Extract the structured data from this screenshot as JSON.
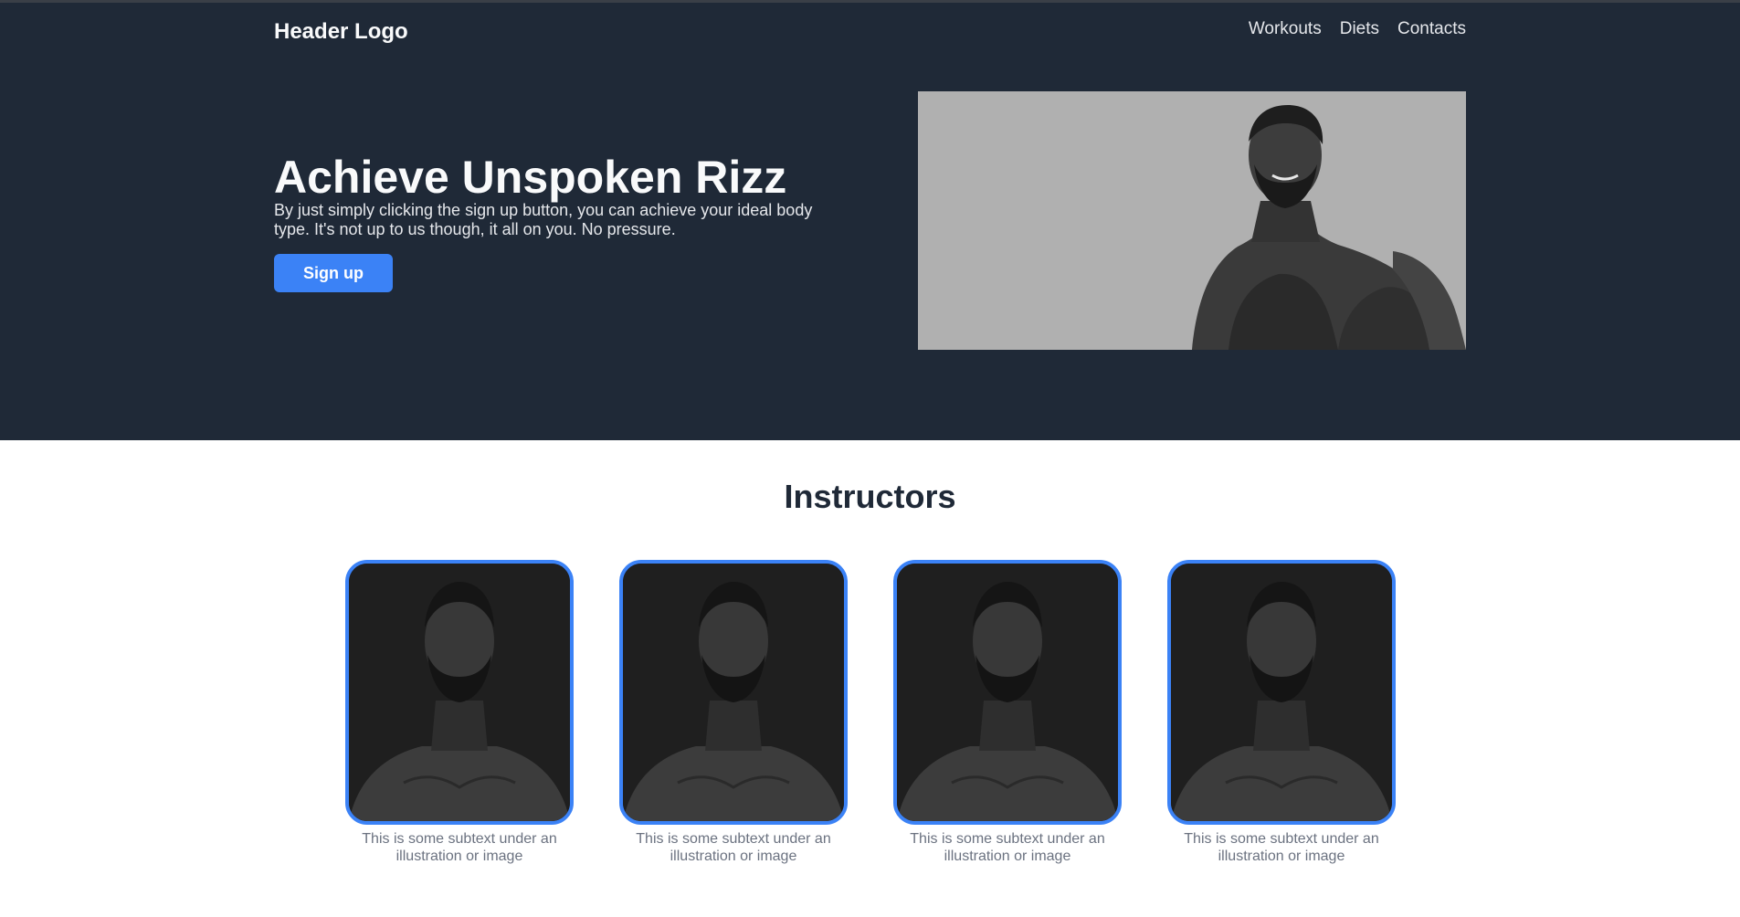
{
  "header": {
    "logo": "Header Logo",
    "nav": [
      {
        "label": "Workouts"
      },
      {
        "label": "Diets"
      },
      {
        "label": "Contacts"
      }
    ]
  },
  "hero": {
    "title": "Achieve Unspoken Rizz",
    "subtitle": "By just simply clicking the sign up button, you can achieve your ideal body type. It's not up to us though, it all on you. No pressure.",
    "cta_label": "Sign up",
    "image_icon": "muscular-man-portrait"
  },
  "instructors": {
    "title": "Instructors",
    "cards": [
      {
        "caption": "This is some subtext under an illustration or image",
        "image_icon": "instructor-portrait"
      },
      {
        "caption": "This is some subtext under an illustration or image",
        "image_icon": "instructor-portrait"
      },
      {
        "caption": "This is some subtext under an illustration or image",
        "image_icon": "instructor-portrait"
      },
      {
        "caption": "This is some subtext under an illustration or image",
        "image_icon": "instructor-portrait"
      }
    ]
  },
  "colors": {
    "hero_bg": "#1f2937",
    "accent": "#3b82f6",
    "caption": "#6b7280",
    "title_dark": "#1f2937"
  }
}
